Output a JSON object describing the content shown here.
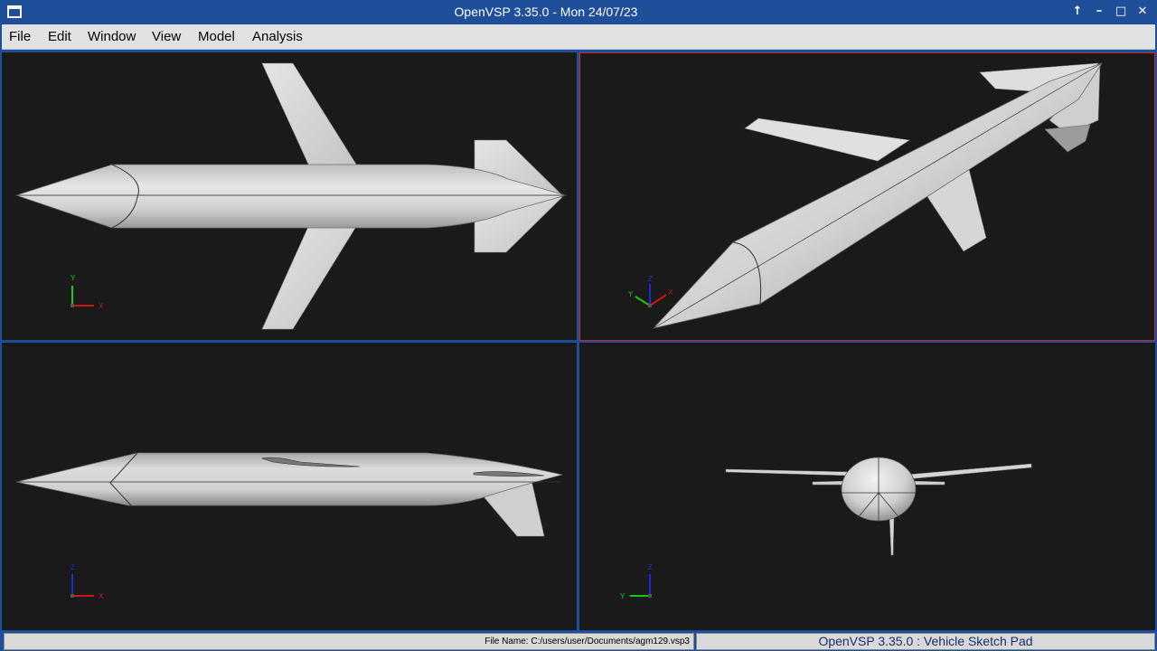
{
  "window": {
    "title": "OpenVSP 3.35.0 - Mon 24/07/23",
    "controls": [
      "↑",
      "–",
      "□",
      "✕"
    ]
  },
  "menu": {
    "file": "File",
    "edit": "Edit",
    "window": "Window",
    "view": "View",
    "model": "Model",
    "analysis": "Analysis"
  },
  "viewports": {
    "top": {
      "axis_a": "Y",
      "axis_b": "X"
    },
    "iso": {
      "axis_a": "Z",
      "axis_b": "X",
      "axis_c": "Y"
    },
    "side": {
      "axis_a": "Z",
      "axis_b": "X"
    },
    "front": {
      "axis_a": "Z",
      "axis_b": "Y"
    }
  },
  "colors": {
    "active_viewport_border": "#d32424",
    "viewport_background": "#1a1a1a",
    "model_surface": "#d6d6d6"
  },
  "status": {
    "file_name": "File Name: C:/users/user/Documents/agm129.vsp3",
    "app_label": "OpenVSP 3.35.0 : Vehicle Sketch Pad"
  }
}
